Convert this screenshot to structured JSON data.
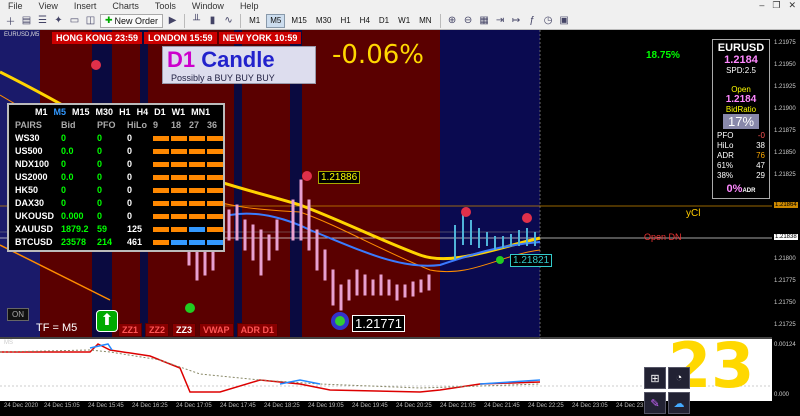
{
  "menu": [
    "File",
    "View",
    "Insert",
    "Charts",
    "Tools",
    "Window",
    "Help"
  ],
  "toolbar": {
    "new_order": "New Order",
    "timeframes": [
      "M1",
      "M5",
      "M15",
      "M30",
      "H1",
      "H4",
      "D1",
      "W1",
      "MN"
    ],
    "selected_tf": "M5"
  },
  "chart": {
    "symbol_label": "EURUSD,M5",
    "sessions": [
      "HONG KONG 23:59",
      "LONDON 15:59",
      "NEW YORK 10:59"
    ],
    "d1_title": "D1",
    "d1_title2": "Candle",
    "d1_sub": "Possibly a BUY BUY BUY",
    "change_pct": "-0.06%",
    "pct2": "18.75%",
    "price_labels": {
      "high": "1.21886",
      "mid": "1.21821",
      "low": "1.21771"
    },
    "ycl": "yCl",
    "open_dn": "Open DN",
    "tf_label": "TF = M5",
    "on_label": "ON",
    "buttons": [
      "ZZ1",
      "ZZ2",
      "ZZ3",
      "VWAP",
      "ADR D1"
    ],
    "big_number": "23",
    "ind_label": "MS",
    "x_ticks": [
      "24 Dec 2020",
      "24 Dec 15:05",
      "24 Dec 15:45",
      "24 Dec 16:25",
      "24 Dec 17:05",
      "24 Dec 17:45",
      "24 Dec 18:25",
      "24 Dec 19:05",
      "24 Dec 19:45",
      "24 Dec 20:25",
      "24 Dec 21:05",
      "24 Dec 21:45",
      "24 Dec 22:25",
      "24 Dec 23:05",
      "24 Dec 23:45"
    ],
    "y_ticks": [
      "1.21975",
      "1.21950",
      "1.21925",
      "1.21900",
      "1.21875",
      "1.21850",
      "1.21825",
      "1.21800",
      "1.21775",
      "1.21750",
      "1.21725",
      "1.21700"
    ],
    "current_price": "1.21838",
    "ycl_price": "1.21864",
    "ind_ticks": [
      "0.00124",
      "0.000"
    ]
  },
  "panel": {
    "tfs": [
      "M1",
      "M5",
      "M15",
      "M30",
      "H1",
      "H4",
      "D1",
      "W1",
      "MN1"
    ],
    "cols": {
      "pairs": "PAIRS",
      "bid": "Bid",
      "pfo": "PFO",
      "hilo": "HiLo",
      "n9": "9",
      "n18": "18",
      "n27": "27",
      "n36": "36"
    },
    "rows": [
      {
        "sym": "WS30",
        "bid": "0",
        "pfo": "0",
        "hilo": "0"
      },
      {
        "sym": "US500",
        "bid": "0.0",
        "pfo": "0",
        "hilo": "0"
      },
      {
        "sym": "NDX100",
        "bid": "0",
        "pfo": "0",
        "hilo": "0"
      },
      {
        "sym": "US2000",
        "bid": "0.0",
        "pfo": "0",
        "hilo": "0"
      },
      {
        "sym": "HK50",
        "bid": "0",
        "pfo": "0",
        "hilo": "0"
      },
      {
        "sym": "DAX30",
        "bid": "0",
        "pfo": "0",
        "hilo": "0"
      },
      {
        "sym": "UKOUSD",
        "bid": "0.000",
        "pfo": "0",
        "hilo": "0"
      },
      {
        "sym": "XAUUSD",
        "bid": "1879.2",
        "pfo": "59",
        "hilo": "125"
      },
      {
        "sym": "BTCUSD",
        "bid": "23578",
        "pfo": "214",
        "hilo": "461"
      }
    ]
  },
  "info": {
    "symbol": "EURUSD",
    "price": "1.2184",
    "spread": "SPD:2.5",
    "open_label": "Open",
    "open": "1.2184",
    "bidratio_label": "BidRatio",
    "bidratio": "17%",
    "stats": [
      [
        "PFO",
        "-0"
      ],
      [
        "HiLo",
        "38"
      ],
      [
        "ADR",
        "76"
      ],
      [
        "61%",
        "47"
      ],
      [
        "38%",
        "29"
      ]
    ],
    "bottom": "0%",
    "bottom_sub": "ADR"
  }
}
